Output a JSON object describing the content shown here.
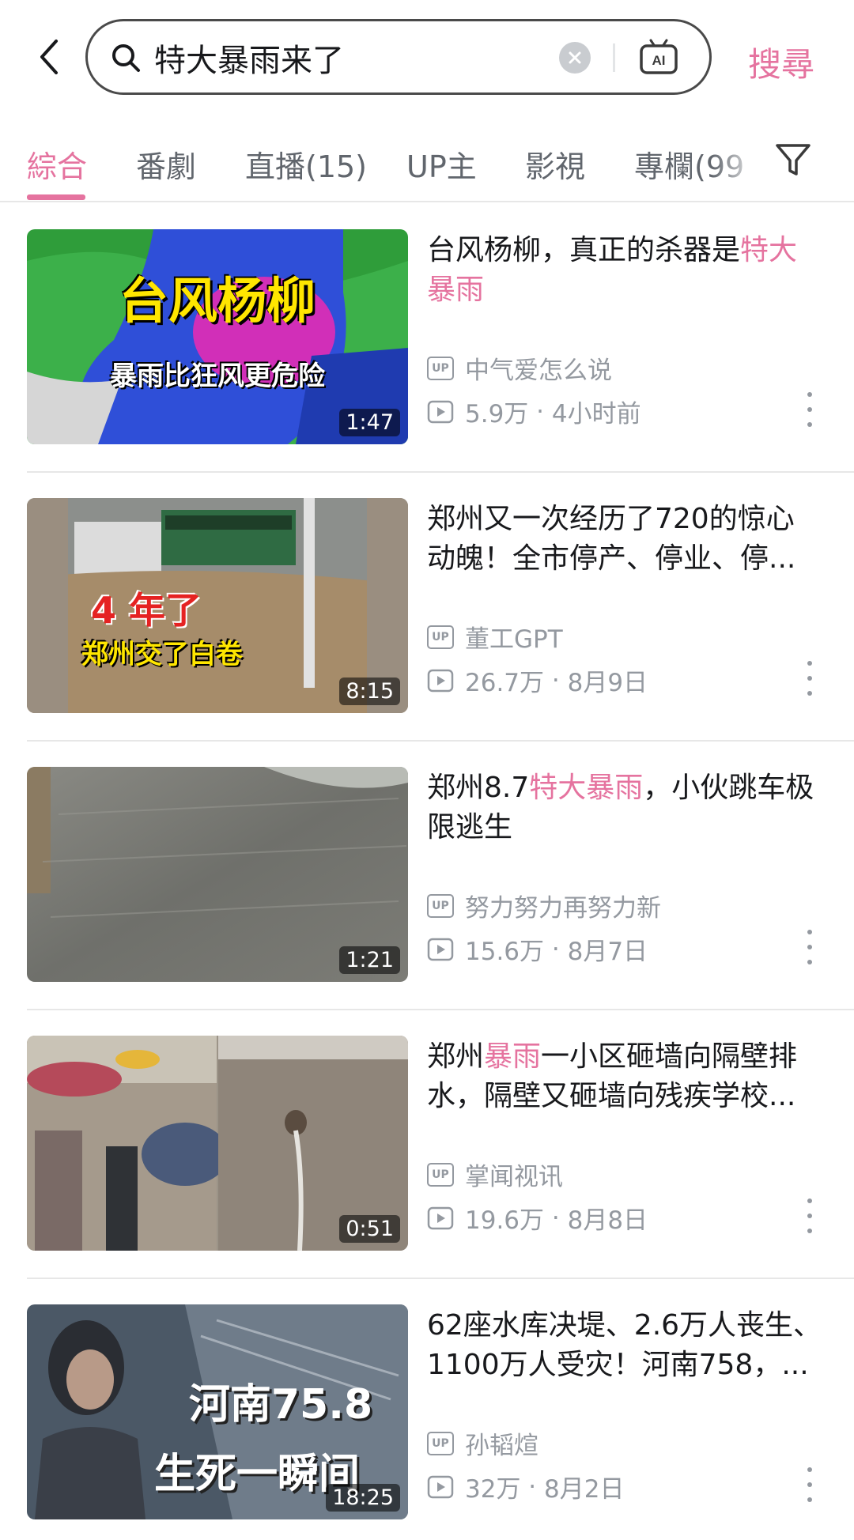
{
  "search": {
    "query": "特大暴雨来了",
    "submit_label": "搜尋",
    "ai_label": "AI"
  },
  "tabs": [
    {
      "label": "綜合",
      "active": true
    },
    {
      "label": "番劇",
      "active": false
    },
    {
      "label": "直播(15)",
      "active": false
    },
    {
      "label": "UP主",
      "active": false
    },
    {
      "label": "影視",
      "active": false
    },
    {
      "label": "專欄(99",
      "active": false
    }
  ],
  "colors": {
    "accent": "#e5739f",
    "text": "#18191c",
    "meta": "#9499a0"
  },
  "results": [
    {
      "title_parts": [
        "台风杨柳，真正的杀器是",
        "特大暴雨",
        ""
      ],
      "uploader": "中气爱怎么说",
      "views": "5.9万",
      "date": "4小时前",
      "duration": "1:47",
      "thumb_line1": "台风杨柳",
      "thumb_line2": "暴雨比狂风更危险"
    },
    {
      "title_parts": [
        "郑州又一次经历了720的惊心动魄！全市停产、停业、停...",
        "",
        ""
      ],
      "uploader": "董工GPT",
      "views": "26.7万",
      "date": "8月9日",
      "duration": "8:15",
      "thumb_line1": "4 年了",
      "thumb_line2": "郑州交了白卷"
    },
    {
      "title_parts": [
        "郑州8.7",
        "特大暴雨",
        "，小伙跳车极限逃生"
      ],
      "uploader": "努力努力再努力新",
      "views": "15.6万",
      "date": "8月7日",
      "duration": "1:21",
      "thumb_line1": "",
      "thumb_line2": ""
    },
    {
      "title_parts": [
        "郑州",
        "暴雨",
        "一小区砸墙向隔壁排水，隔壁又砸墙向残疾学校..."
      ],
      "uploader": "掌闻视讯",
      "views": "19.6万",
      "date": "8月8日",
      "duration": "0:51",
      "thumb_line1": "",
      "thumb_line2": ""
    },
    {
      "title_parts": [
        "62座水库决堤、2.6万人丧生、1100万人受灾！河南758，...",
        "",
        ""
      ],
      "uploader": "孙韬煊",
      "views": "32万",
      "date": "8月2日",
      "duration": "18:25",
      "thumb_line1": "河南75.8",
      "thumb_line2": "生死一瞬间"
    }
  ]
}
